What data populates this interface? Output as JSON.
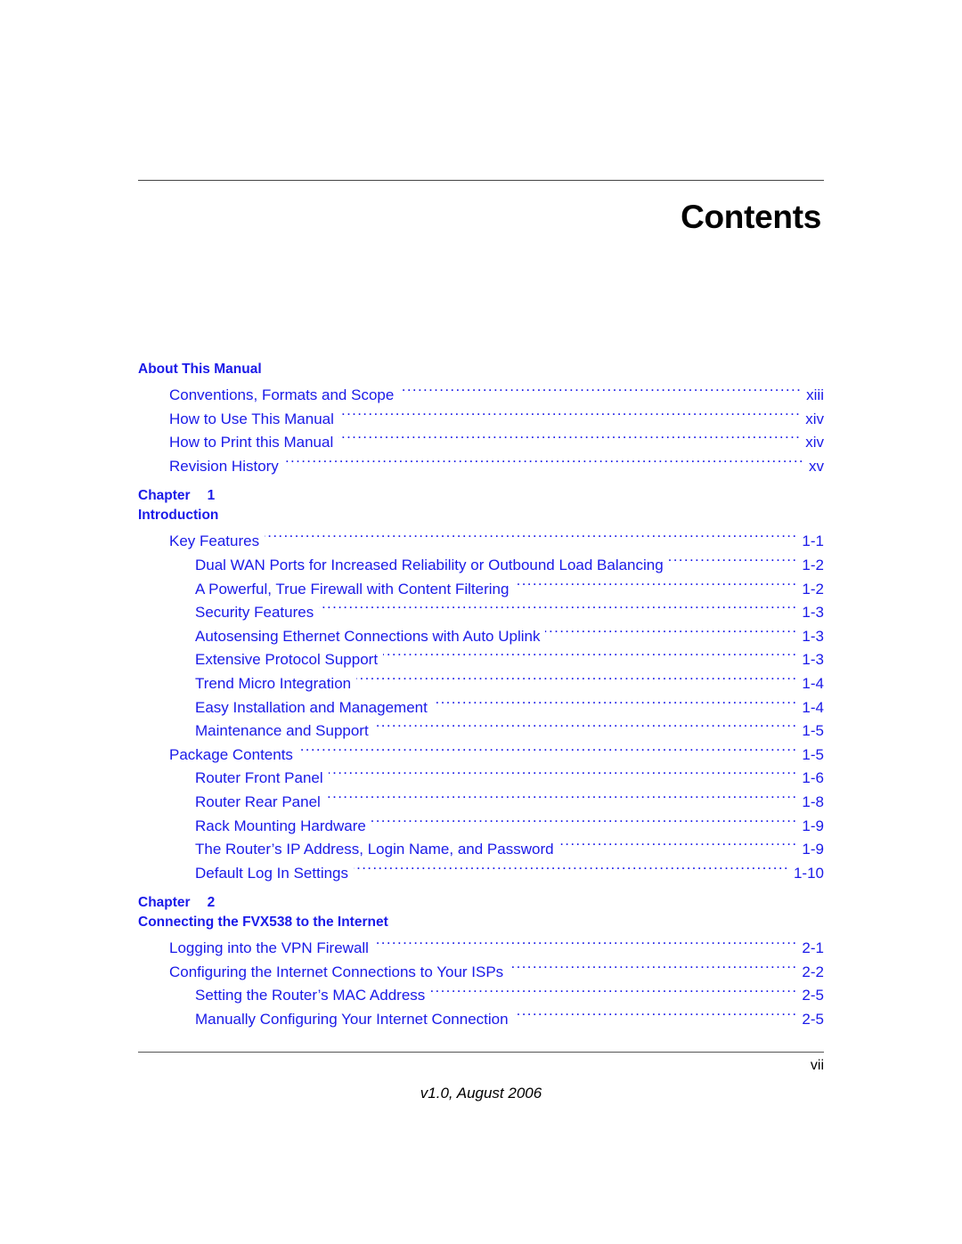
{
  "document": {
    "page_title": "Contents",
    "folio": "vii",
    "version_line": "v1.0, August 2006",
    "accent_color": "#1a1aE8",
    "text_color": "#000000",
    "rule_color": "#444444"
  },
  "toc": {
    "sections": [
      {
        "kind": "front-matter",
        "heading": "About This Manual",
        "chapter_word": "",
        "chapter_number": "",
        "subtitle": "",
        "entries": [
          {
            "level": 1,
            "title": "Conventions, Formats and Scope",
            "page": "xiii"
          },
          {
            "level": 1,
            "title": "How to Use This Manual",
            "page": "xiv"
          },
          {
            "level": 1,
            "title": "How to Print this Manual",
            "page": "xiv"
          },
          {
            "level": 1,
            "title": "Revision History",
            "page": "xv"
          }
        ]
      },
      {
        "kind": "chapter",
        "heading": "",
        "chapter_word": "Chapter",
        "chapter_number": "1",
        "subtitle": "Introduction",
        "entries": [
          {
            "level": 1,
            "title": "Key Features",
            "page": "1-1"
          },
          {
            "level": 2,
            "title": "Dual WAN Ports for Increased Reliability or Outbound Load Balancing",
            "page": "1-2"
          },
          {
            "level": 2,
            "title": "A Powerful, True Firewall with Content Filtering",
            "page": "1-2"
          },
          {
            "level": 2,
            "title": "Security Features",
            "page": "1-3"
          },
          {
            "level": 2,
            "title": "Autosensing Ethernet Connections with Auto Uplink",
            "page": "1-3"
          },
          {
            "level": 2,
            "title": "Extensive Protocol Support",
            "page": "1-3"
          },
          {
            "level": 2,
            "title": "Trend Micro Integration",
            "page": "1-4"
          },
          {
            "level": 2,
            "title": "Easy Installation and Management",
            "page": "1-4"
          },
          {
            "level": 2,
            "title": "Maintenance and Support",
            "page": "1-5"
          },
          {
            "level": 1,
            "title": "Package Contents",
            "page": "1-5"
          },
          {
            "level": 2,
            "title": "Router Front Panel",
            "page": "1-6"
          },
          {
            "level": 2,
            "title": "Router Rear Panel",
            "page": "1-8"
          },
          {
            "level": 2,
            "title": "Rack Mounting Hardware",
            "page": "1-9"
          },
          {
            "level": 2,
            "title": "The Router’s IP Address, Login Name, and Password",
            "page": "1-9"
          },
          {
            "level": 2,
            "title": "Default Log In Settings",
            "page": "1-10"
          }
        ]
      },
      {
        "kind": "chapter",
        "heading": "",
        "chapter_word": "Chapter",
        "chapter_number": "2",
        "subtitle": "Connecting the FVX538 to the Internet",
        "entries": [
          {
            "level": 1,
            "title": "Logging into the VPN Firewall",
            "page": "2-1"
          },
          {
            "level": 1,
            "title": "Configuring the Internet Connections to Your ISPs",
            "page": "2-2"
          },
          {
            "level": 2,
            "title": "Setting the Router’s MAC Address",
            "page": "2-5"
          },
          {
            "level": 2,
            "title": "Manually Configuring Your Internet Connection",
            "page": "2-5"
          }
        ]
      }
    ]
  }
}
